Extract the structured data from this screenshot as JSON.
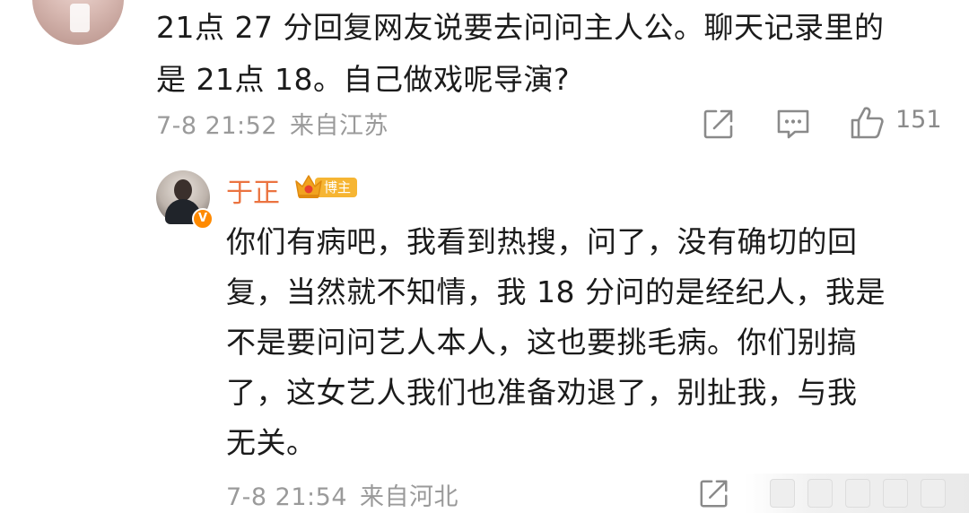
{
  "top_comment": {
    "text": "21点 27 分回复网友说要去问问主人公。聊天记录里的\n是 21点 18。自己做戏呢导演?",
    "date": "7-8 21:52",
    "location": "来自江苏",
    "like_count": "151"
  },
  "reply": {
    "name": "于正",
    "badge": "博主",
    "verified_mark": "V",
    "text": "你们有病吧，我看到热搜，问了，没有确切的回\n复，当然就不知情，我 18 分问的是经纪人，我是\n不是要问问艺人本人，这也要挑毛病。你们别搞\n了，这女艺人我们也准备劝退了，别扯我，与我\n无关。",
    "date": "7-8 21:54",
    "location": "来自河北"
  },
  "colors": {
    "name": "#eb7340",
    "meta": "#9a9a9a",
    "badge": "#f6b533",
    "verified": "#ff8a00"
  },
  "icons": [
    "share-icon",
    "comment-icon",
    "like-icon"
  ]
}
